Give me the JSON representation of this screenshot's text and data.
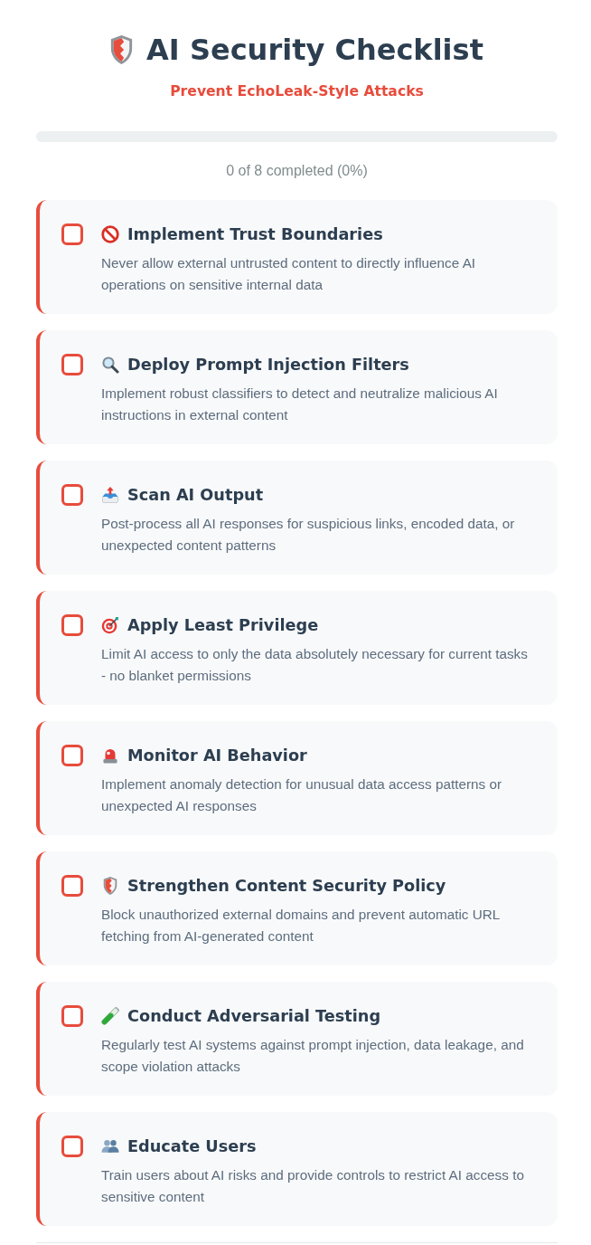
{
  "header": {
    "title": "AI Security Checklist",
    "subtitle": "Prevent EchoLeak-Style Attacks"
  },
  "progress": {
    "level": 0,
    "label": "0 of 8 completed (0%)"
  },
  "items": [
    {
      "title": "Implement Trust Boundaries",
      "description": "Never allow external untrusted content to directly influence AI operations on sensitive internal data",
      "checked": false
    },
    {
      "title": "Deploy Prompt Injection Filters",
      "description": "Implement robust classifiers to detect and neutralize malicious AI instructions in external content",
      "checked": false
    },
    {
      "title": "Scan AI Output",
      "description": "Post-process all AI responses for suspicious links, encoded data, or unexpected content patterns",
      "checked": false
    },
    {
      "title": "Apply Least Privilege",
      "description": "Limit AI access to only the data absolutely necessary for current tasks - no blanket permissions",
      "checked": false
    },
    {
      "title": "Monitor AI Behavior",
      "description": "Implement anomaly detection for unusual data access patterns or unexpected AI responses",
      "checked": false
    },
    {
      "title": "Strengthen Content Security Policy",
      "description": "Block unauthorized external domains and prevent automatic URL fetching from AI-generated content",
      "checked": false
    },
    {
      "title": "Conduct Adversarial Testing",
      "description": "Regularly test AI systems against prompt injection, data leakage, and scope violation attacks",
      "checked": false
    },
    {
      "title": "Educate Users",
      "description": "Train users about AI risks and provide controls to restrict AI access to sensitive content",
      "checked": false
    }
  ]
}
